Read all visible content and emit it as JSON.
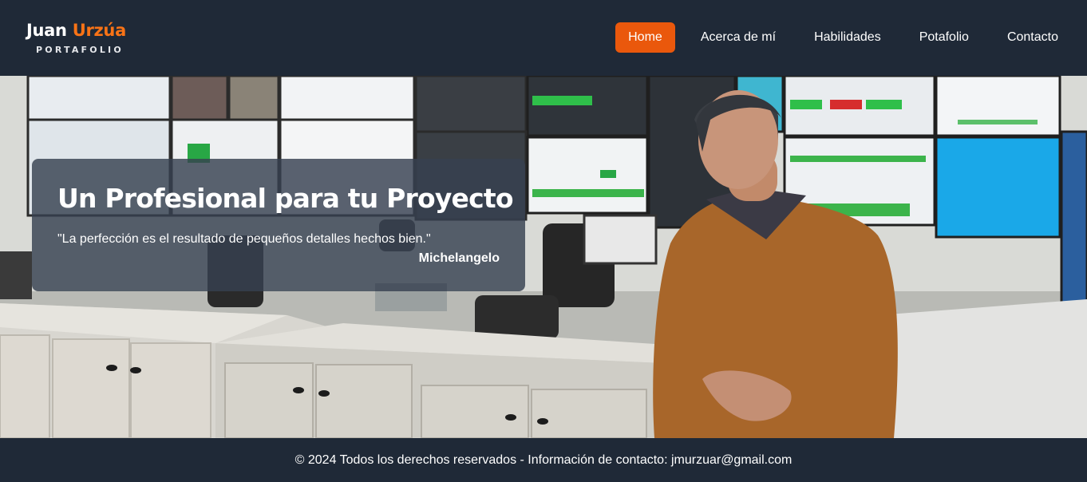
{
  "header": {
    "logo": {
      "first_name": "Juan",
      "last_name": "Urzúa",
      "subtitle": "PORTAFOLIO"
    },
    "nav": [
      {
        "label": "Home",
        "active": true
      },
      {
        "label": "Acerca de mí",
        "active": false
      },
      {
        "label": "Habilidades",
        "active": false
      },
      {
        "label": "Potafolio",
        "active": false
      },
      {
        "label": "Contacto",
        "active": false
      }
    ]
  },
  "hero": {
    "title": "Un Profesional para tu Proyecto",
    "quote": "\"La perfección es el resultado de pequeños detalles hechos bien.\"",
    "author": "Michelangelo",
    "image_icon": "photo-control-room"
  },
  "footer": {
    "text": "© 2024 Todos los derechos reservados - Información de contacto: jmurzuar@gmail.com"
  },
  "colors": {
    "background": "#1f2937",
    "accent": "#ea580c",
    "logo_accent": "#f97316",
    "card_overlay": "#374151"
  }
}
